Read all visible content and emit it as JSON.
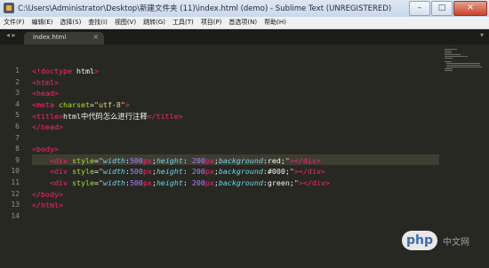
{
  "window": {
    "title": "C:\\Users\\Administrator\\Desktop\\新建文件夹 (11)\\index.html (demo) - Sublime Text (UNREGISTERED)"
  },
  "window_controls": {
    "minimize": "–",
    "maximize": "□",
    "close": "✕"
  },
  "menu": [
    "文件(F)",
    "编辑(E)",
    "选择(S)",
    "查找(I)",
    "视图(V)",
    "跳转(G)",
    "工具(T)",
    "项目(P)",
    "首选项(N)",
    "帮助(H)"
  ],
  "tabs": {
    "nav": "◂ ▸",
    "active": "index.html",
    "close": "×",
    "dropdown": "▾"
  },
  "editor": {
    "line_numbers": [
      "1",
      "2",
      "3",
      "4",
      "5",
      "6",
      "7",
      "8",
      "9",
      "10",
      "11",
      "12",
      "13",
      "14"
    ],
    "active_line": 9,
    "lines": [
      {
        "tokens": [
          {
            "c": "t",
            "v": "<!doctype"
          },
          {
            "c": "p",
            "v": " html"
          },
          {
            "c": "t",
            "v": ">"
          }
        ]
      },
      {
        "tokens": [
          {
            "c": "t",
            "v": "<html>"
          }
        ]
      },
      {
        "tokens": [
          {
            "c": "t",
            "v": "<head>"
          }
        ]
      },
      {
        "tokens": [
          {
            "c": "t",
            "v": "<meta"
          },
          {
            "c": "a",
            "v": " charset"
          },
          {
            "c": "p",
            "v": "="
          },
          {
            "c": "s",
            "v": "\"utf-8\""
          },
          {
            "c": "t",
            "v": ">"
          }
        ]
      },
      {
        "tokens": [
          {
            "c": "t",
            "v": "<title>"
          },
          {
            "c": "p",
            "v": "html中代码怎么进行注释"
          },
          {
            "c": "t",
            "v": "</title>"
          }
        ]
      },
      {
        "tokens": [
          {
            "c": "t",
            "v": "</head>"
          }
        ]
      },
      {
        "tokens": []
      },
      {
        "tokens": [
          {
            "c": "t",
            "v": "<body>"
          }
        ]
      },
      {
        "tokens": [
          {
            "c": "p",
            "v": "    "
          },
          {
            "c": "t",
            "v": "<div"
          },
          {
            "c": "a",
            "v": " style"
          },
          {
            "c": "p",
            "v": "="
          },
          {
            "c": "s",
            "v": "\""
          },
          {
            "c": "pr",
            "v": "width"
          },
          {
            "c": "p",
            "v": ":"
          },
          {
            "c": "n",
            "v": "500"
          },
          {
            "c": "u",
            "v": "px"
          },
          {
            "c": "p",
            "v": ";"
          },
          {
            "c": "pr",
            "v": "height"
          },
          {
            "c": "p",
            "v": ": "
          },
          {
            "c": "n",
            "v": "200"
          },
          {
            "c": "u",
            "v": "px"
          },
          {
            "c": "p",
            "v": ";"
          },
          {
            "c": "pr",
            "v": "background"
          },
          {
            "c": "p",
            "v": ":red;"
          },
          {
            "c": "s",
            "v": "\""
          },
          {
            "c": "t",
            "v": "></div>"
          }
        ]
      },
      {
        "tokens": [
          {
            "c": "p",
            "v": "    "
          },
          {
            "c": "t",
            "v": "<div"
          },
          {
            "c": "a",
            "v": " style"
          },
          {
            "c": "p",
            "v": "="
          },
          {
            "c": "s",
            "v": "\""
          },
          {
            "c": "pr",
            "v": "width"
          },
          {
            "c": "p",
            "v": ":"
          },
          {
            "c": "n",
            "v": "500"
          },
          {
            "c": "u",
            "v": "px"
          },
          {
            "c": "p",
            "v": ";"
          },
          {
            "c": "pr",
            "v": "height"
          },
          {
            "c": "p",
            "v": ": "
          },
          {
            "c": "n",
            "v": "200"
          },
          {
            "c": "u",
            "v": "px"
          },
          {
            "c": "p",
            "v": ";"
          },
          {
            "c": "pr",
            "v": "background"
          },
          {
            "c": "p",
            "v": ":#000;"
          },
          {
            "c": "s",
            "v": "\""
          },
          {
            "c": "t",
            "v": "></div>"
          }
        ]
      },
      {
        "tokens": [
          {
            "c": "p",
            "v": "    "
          },
          {
            "c": "t",
            "v": "<div"
          },
          {
            "c": "a",
            "v": " style"
          },
          {
            "c": "p",
            "v": "="
          },
          {
            "c": "s",
            "v": "\""
          },
          {
            "c": "pr",
            "v": "width"
          },
          {
            "c": "p",
            "v": ":"
          },
          {
            "c": "n",
            "v": "500"
          },
          {
            "c": "u",
            "v": "px"
          },
          {
            "c": "p",
            "v": ";"
          },
          {
            "c": "pr",
            "v": "height"
          },
          {
            "c": "p",
            "v": ": "
          },
          {
            "c": "n",
            "v": "200"
          },
          {
            "c": "u",
            "v": "px"
          },
          {
            "c": "p",
            "v": ";"
          },
          {
            "c": "pr",
            "v": "background"
          },
          {
            "c": "p",
            "v": ":green;"
          },
          {
            "c": "s",
            "v": "\""
          },
          {
            "c": "t",
            "v": "></div>"
          }
        ]
      },
      {
        "tokens": [
          {
            "c": "t",
            "v": "</body>"
          }
        ]
      },
      {
        "tokens": [
          {
            "c": "t",
            "v": "</html>"
          }
        ]
      },
      {
        "tokens": []
      }
    ]
  },
  "watermark": {
    "logo": "php",
    "site": "中文网"
  },
  "colors": {
    "bg": "#272822",
    "tag": "#f92672",
    "attr": "#a6e22e",
    "string": "#e6db74",
    "property": "#66d9ef",
    "number": "#ae81ff"
  }
}
